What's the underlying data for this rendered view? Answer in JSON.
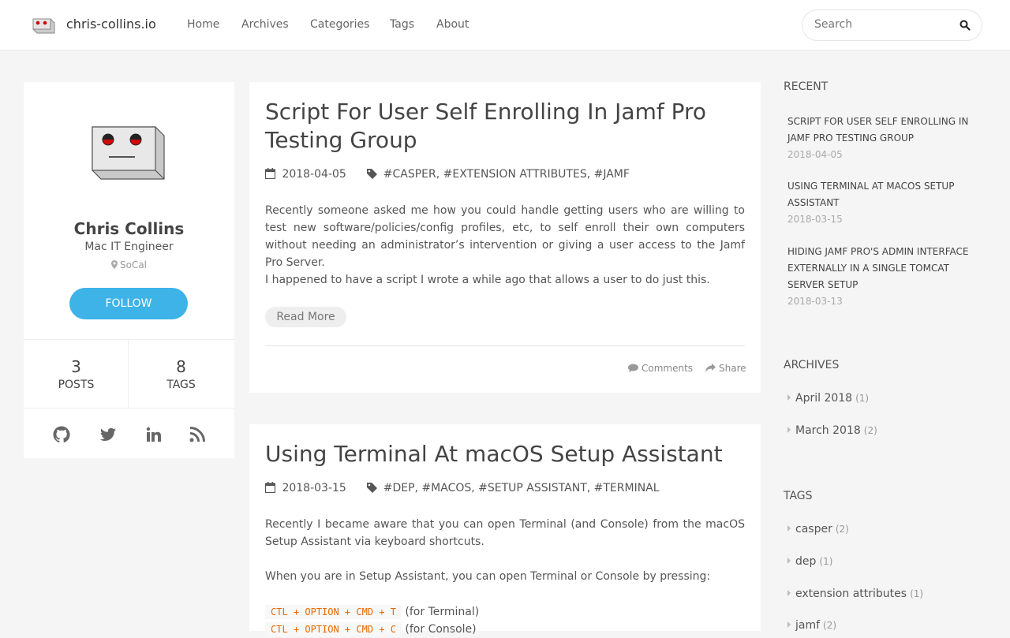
{
  "header": {
    "brand": "chris-collins.io",
    "nav": [
      "Home",
      "Archives",
      "Categories",
      "Tags",
      "About"
    ],
    "search_placeholder": "Search"
  },
  "profile": {
    "name": "Chris Collins",
    "role": "Mac IT Engineer",
    "location": "SoCal",
    "follow_label": "FOLLOW",
    "posts_count": "3",
    "posts_label": "POSTS",
    "tags_count": "8",
    "tags_label": "TAGS",
    "social_icons": [
      "github-icon",
      "twitter-icon",
      "linkedin-icon",
      "rss-icon"
    ]
  },
  "posts": [
    {
      "title": "Script For User Self Enrolling In Jamf Pro Testing Group",
      "date": "2018-04-05",
      "tags": "#CASPER, #EXTENSION ATTRIBUTES, #JAMF",
      "para1": "Recently someone asked me how you could handle getting users who are willing to test new software/policies/config profiles, etc, to self enroll their own computers without needing an administrator’s intervention or giving a user access to the Jamf Pro Server.",
      "para2": "I happened to have a script I wrote a while ago that allows a user to do just this.",
      "read_more": "Read More",
      "comments": "Comments",
      "share": "Share"
    },
    {
      "title": "Using Terminal At macOS Setup Assistant",
      "date": "2018-03-15",
      "tags": "#DEP, #MACOS, #SETUP ASSISTANT, #TERMINAL",
      "para1": "Recently I became aware that you can open Terminal (and Console) from the macOS Setup Assistant via keyboard shortcuts.",
      "para2": "When you are in Setup Assistant, you can open Terminal or Console by pressing:",
      "code1": "CTL + OPTION + CMD + T",
      "code1_note": "(for Terminal)",
      "code2": "CTL + OPTION + CMD + C",
      "code2_note": "(for Console)"
    }
  ],
  "sidebar": {
    "recent_heading": "RECENT",
    "recent": [
      {
        "title": "Script For User Self Enrolling In Jamf Pro Testing Group",
        "date": "2018-04-05"
      },
      {
        "title": "Using Terminal At macOS Setup Assistant",
        "date": "2018-03-15"
      },
      {
        "title": "Hiding Jamf Pro's Admin Interface Externally In A Single Tomcat Server Setup",
        "date": "2018-03-13"
      }
    ],
    "archives_heading": "ARCHIVES",
    "archives": [
      {
        "label": "April 2018",
        "count": "(1)"
      },
      {
        "label": "March 2018",
        "count": "(2)"
      }
    ],
    "tags_heading": "TAGS",
    "tags": [
      {
        "label": "casper",
        "count": "(2)"
      },
      {
        "label": "dep",
        "count": "(1)"
      },
      {
        "label": "extension attributes",
        "count": "(1)"
      },
      {
        "label": "jamf",
        "count": "(2)"
      }
    ]
  },
  "colors": {
    "accent": "#3db3e8",
    "code": "#e96900"
  }
}
